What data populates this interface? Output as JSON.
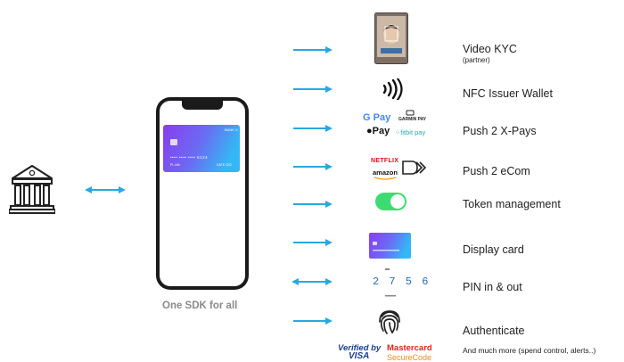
{
  "caption": "One SDK for all",
  "features": [
    {
      "label": "Video KYC",
      "sub": "(partner)",
      "icon": "video-kyc-icon"
    },
    {
      "label": "NFC Issuer Wallet",
      "icon": "contactless-icon"
    },
    {
      "label": "Push 2 X-Pays",
      "icon": "x-pays-logos-icon"
    },
    {
      "label": "Push 2 eCom",
      "icon": "ecom-logos-icon"
    },
    {
      "label": "Token management",
      "icon": "toggle-switch-icon"
    },
    {
      "label": "Display card",
      "icon": "card-icon"
    },
    {
      "label": "PIN in & out",
      "icon": "pin-icon"
    },
    {
      "label": "Authenticate",
      "icon": "fingerprint-icon"
    },
    {
      "label": "And much more (spend control, alerts..)",
      "icon": "card-scheme-logos-icon"
    }
  ],
  "logos": {
    "gpay": "G Pay",
    "garmin": "GARMIN PAY",
    "applepay": "Pay",
    "fitbit": "fitbit pay",
    "netflix": "NETFLIX",
    "amazon": "amazon",
    "pin_digits": "2 7 5 6",
    "verified_by": "Verified by",
    "visa": "VISA",
    "mastercard": "Mastercard",
    "securecode": "SecureCode"
  },
  "phone_card": {
    "bank": "BANK X",
    "number": "•••• •••• •••• 6124",
    "name": "PL UM",
    "expiry": "DATE 12/2"
  },
  "colors": {
    "arrow": "#29a8e0",
    "card_start": "#8a3cf0",
    "card_end": "#34b7f5",
    "toggle": "#3ddc72",
    "caption": "#8a8a8a"
  }
}
